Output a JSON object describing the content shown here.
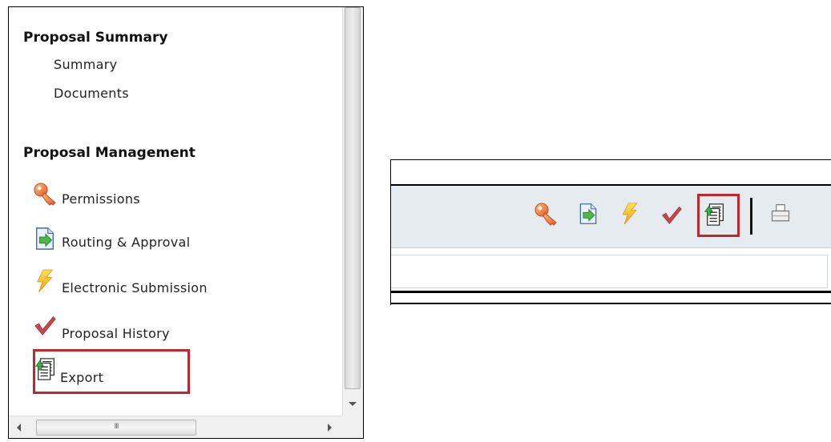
{
  "sidebar": {
    "sections": [
      {
        "title": "Proposal Summary",
        "links": [
          "Summary",
          "Documents"
        ]
      },
      {
        "title": "Proposal Management",
        "items": [
          {
            "label": "Permissions",
            "icon": "key-icon"
          },
          {
            "label": "Routing & Approval",
            "icon": "routing-icon"
          },
          {
            "label": "Electronic Submission",
            "icon": "lightning-icon"
          },
          {
            "label": "Proposal History",
            "icon": "checkmark-icon"
          },
          {
            "label": "Export",
            "icon": "export-icon"
          }
        ]
      }
    ],
    "scroll_thumb_glyph": "III"
  },
  "toolbar": {
    "icons": [
      "key-icon",
      "routing-icon",
      "lightning-icon",
      "checkmark-icon",
      "export-icon",
      "print-icon"
    ],
    "highlighted": "export-icon"
  },
  "colors": {
    "highlight": "#c0272d",
    "toolbar_bg": "#e6ebef"
  }
}
